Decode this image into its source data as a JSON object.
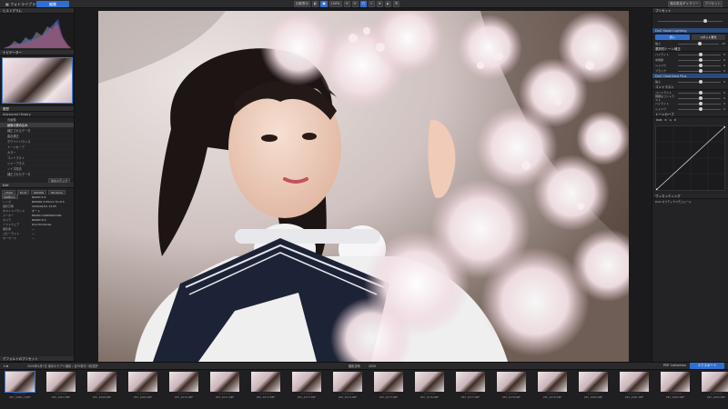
{
  "header": {
    "library_tab": "フォトライブラリ",
    "edit_tab": "編集",
    "tools": [
      "比較表示",
      "◧",
      "▣",
      "100%",
      "⟲",
      "⟳",
      "☐",
      "✂",
      "⊕",
      "◐",
      "☰"
    ],
    "right_button": "適応設定ギャラリー",
    "right_sub": "プリセット"
  },
  "left_panel": {
    "histogram_title": "ヒストグラム",
    "navigator_title": "ナビゲーター",
    "history_title": "履歴",
    "history_header": "Advanced History",
    "history_items": [
      "元画像",
      "画像の読み込み",
      "補正されたデータ",
      "露出補正",
      "ホワイトバランス",
      "トーンカーブ",
      "カラー",
      "コントラスト",
      "シャープネス",
      "ノイズ除去",
      "補正されたデータ"
    ],
    "history_selected": 1,
    "history_buttons": [
      "次のステップ"
    ],
    "exif_title": "Exif",
    "exif_buttons": [
      "1/500",
      "f/1.8",
      "ISO100",
      "85.0mm",
      "100mm"
    ],
    "exif_rows": [
      {
        "k": "カメラ",
        "v": "NIKON Z 6"
      },
      {
        "k": "レンズ",
        "v": "NIKKOR Z 85mm f/1.8 S"
      },
      {
        "k": "撮影日時",
        "v": "2020/04/01 14:05"
      },
      {
        "k": "ホワイトバランス",
        "v": "オート"
      },
      {
        "k": "メーカー",
        "v": "NIKON CORPORATION"
      },
      {
        "k": "カメラ",
        "v": "NIKON Z 6"
      },
      {
        "k": "ソフトウェア",
        "v": "DxO PhotoLab"
      },
      {
        "k": "撮影者",
        "v": "---"
      },
      {
        "k": "コピーライト",
        "v": "---"
      },
      {
        "k": "キーワード",
        "v": "---"
      }
    ],
    "footer": "デフォルトのプリセット"
  },
  "right_panel": {
    "presets_label": "プリセット",
    "section_lighting": "DxO Smart Lighting",
    "mode_buttons": [
      "弱い",
      "スポット測光"
    ],
    "lighting_sliders": [
      {
        "label": "強さ",
        "val": "25"
      }
    ],
    "section_tone": "選択的トーン補正",
    "tone_sliders": [
      {
        "label": "ハイライト",
        "val": "0"
      },
      {
        "label": "中間調",
        "val": "0"
      },
      {
        "label": "シャドウ",
        "val": "0"
      },
      {
        "label": "ブラック",
        "val": "0"
      }
    ],
    "section_clearview": "DxO ClearView Plus",
    "clearview_sliders": [
      {
        "label": "強さ",
        "val": "0"
      }
    ],
    "contrast_section": "コントラスト",
    "contrast_sliders": [
      {
        "label": "コントラスト",
        "val": "0"
      },
      {
        "label": "微細なコントラスト",
        "val": "0"
      },
      {
        "label": "ハイライト",
        "val": "0"
      },
      {
        "label": "シャドウ",
        "val": "0"
      }
    ],
    "curve_title": "トーンカーブ",
    "curve_tabs": [
      "RGB",
      "R",
      "G",
      "B"
    ],
    "vignette_section": "ヴィネッティング",
    "vignette_value": "DxO オプティクスモジュール"
  },
  "filmstrip": {
    "toolbar_text": "2020年4月7日 東京のモデル撮影 / 全39枚中 1枚選択",
    "sort_text": "撮影日時",
    "sort_value": "2020",
    "collection_button": "PDF Collection",
    "export_button": "エクスポート",
    "files": [
      "Z6Y_2066_1.NEF",
      "Z6Y_2067.NEF",
      "Z6Y_2068.NEF",
      "Z6Y_2069.NEF",
      "Z6Y_2070.NEF",
      "Z6Y_2071.NEF",
      "Z6Y_2072.NEF",
      "Z6Y_2073.NEF",
      "Z6Y_2074.NEF",
      "Z6Y_2075.NEF",
      "Z6Y_2076.NEF",
      "Z6Y_2077.NEF",
      "Z6Y_2078.NEF",
      "Z6Y_2079.NEF",
      "Z6Y_2080.NEF",
      "Z6Y_2081.NEF",
      "Z6Y_2082.NEF",
      "Z6Y_2083.NEF"
    ],
    "stars": "☆☆☆☆☆"
  },
  "colors": {
    "accent": "#2f6fd1",
    "panel": "#232326",
    "background": "#1b1b1d"
  }
}
